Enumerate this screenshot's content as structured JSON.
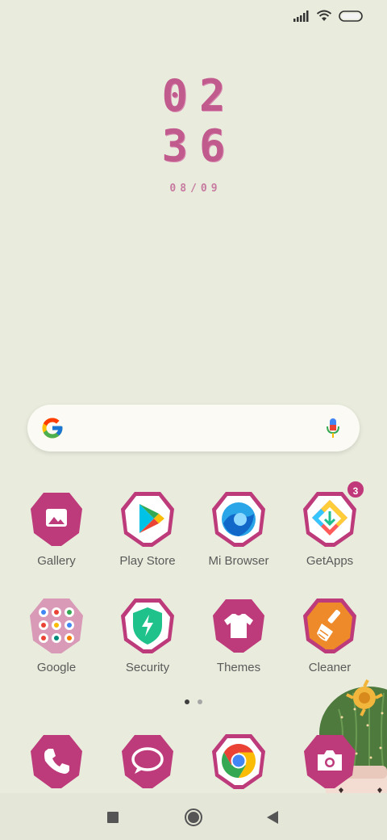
{
  "status_bar": {
    "icons": [
      "signal-icon",
      "wifi-icon",
      "battery-icon"
    ]
  },
  "clock": {
    "hour": "02",
    "minute": "36",
    "date": "08/09"
  },
  "search": {
    "icons": [
      "google-logo",
      "mic-icon"
    ]
  },
  "apps": [
    {
      "label": "Gallery",
      "icon": "gallery-icon"
    },
    {
      "label": "Play Store",
      "icon": "play-store-icon"
    },
    {
      "label": "Mi Browser",
      "icon": "mi-browser-icon"
    },
    {
      "label": "GetApps",
      "icon": "getapps-icon",
      "badge": "3"
    },
    {
      "label": "Google",
      "icon": "google-folder-icon"
    },
    {
      "label": "Security",
      "icon": "security-icon"
    },
    {
      "label": "Themes",
      "icon": "themes-icon"
    },
    {
      "label": "Cleaner",
      "icon": "cleaner-icon"
    }
  ],
  "page_indicator": {
    "pages": 2,
    "active": 1
  },
  "dock": [
    {
      "icon": "phone-icon"
    },
    {
      "icon": "messages-icon"
    },
    {
      "icon": "chrome-icon"
    },
    {
      "icon": "camera-icon"
    }
  ],
  "nav": {
    "buttons": [
      "recents-button",
      "home-button",
      "back-button"
    ]
  },
  "colors": {
    "background": "#e9ecdd",
    "accent": "#c0377a",
    "clock": "#c15a8d"
  }
}
